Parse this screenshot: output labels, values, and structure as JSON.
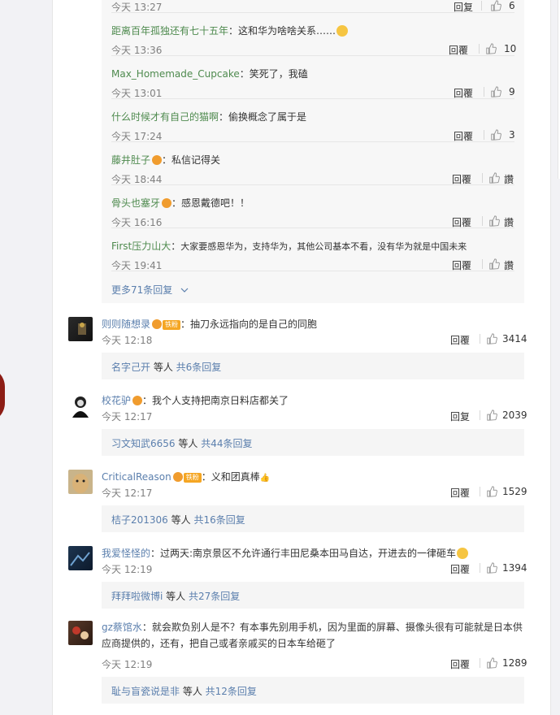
{
  "replies": [
    {
      "user": "",
      "text": "",
      "time": "今天 13:27",
      "reply": "回复",
      "likes": "6"
    },
    {
      "user": "距离百年孤独还有七十五年",
      "text": "这和华为啥啥关系……",
      "emoji": "true",
      "time": "今天 13:36",
      "reply": "回覆",
      "likes": "10"
    },
    {
      "user": "Max_Homemade_Cupcake",
      "text": "笑死了，我磕",
      "time": "今天 13:01",
      "reply": "回覆",
      "likes": "9"
    },
    {
      "user": "什么时候才有自己的猫啊",
      "text": "偷换概念了属于是",
      "time": "今天 17:24",
      "reply": "回覆",
      "likes": "3"
    },
    {
      "user": "藤井肚子",
      "text": "私信记得关",
      "time": "今天 18:44",
      "reply": "回覆",
      "likes": "讚"
    },
    {
      "user": "骨头也塞牙",
      "text": "感恩戴德吧！！",
      "time": "今天 16:16",
      "reply": "回覆",
      "likes": "讚"
    },
    {
      "user": "First压力山大",
      "text": "大家要感恩华为，支持华为，其他公司基本不看，没有华为就是中国未来",
      "time": "今天 19:41",
      "reply": "回覆",
      "likes": "讚"
    }
  ],
  "more_replies": "更多71条回复",
  "comments": [
    {
      "user": "则则随想录",
      "badge": "铁粉",
      "text": "：抽刀永远指向的是自己的同胞",
      "time": "今天 12:18",
      "reply": "回覆",
      "likes": "3414",
      "sub_user": "名字己开",
      "sub_rest": " 等人 ",
      "sub_count": "共6条回复"
    },
    {
      "user": "校花驴",
      "text": "：我个人支持把南京日料店都关了",
      "time": "今天 12:17",
      "reply": "回复",
      "likes": "2039",
      "sub_user": "习文知武6656",
      "sub_rest": " 等人 ",
      "sub_count": "共44条回复"
    },
    {
      "user": "CriticalReason",
      "badge": "铁粉",
      "text": "：义和团真棒",
      "time": "今天 12:17",
      "reply": "回覆",
      "likes": "1529",
      "sub_user": "桔子201306",
      "sub_rest": " 等人 ",
      "sub_count": "共16条回复"
    },
    {
      "user": "我爱怪怪的",
      "text": "：过两天:南京景区不允许通行丰田尼桑本田马自达，开进去的一律砸车",
      "time": "今天 12:19",
      "reply": "回覆",
      "likes": "1394",
      "sub_user": "拜拜啦微博i",
      "sub_rest": " 等人 ",
      "sub_count": "共27条回复"
    },
    {
      "user": "gz蔡馆水",
      "text": "：就会欺负别人是不？有本事先别用手机，因为里面的屏幕、摄像头很有可能就是日本供应商提供的，还有，把自己或者亲戚买的日本车给砸了",
      "time": "今天 12:19",
      "reply": "回覆",
      "likes": "1289",
      "sub_user": "耻与盲瓷说是非",
      "sub_rest": " 等人 ",
      "sub_count": "共12条回复"
    }
  ],
  "colors": {
    "username": "#5b7fad",
    "reply_username": "#4e8a4e",
    "meta": "#808080",
    "panel": "#f7f7f7"
  },
  "icons": [
    "thumbs-up-icon",
    "chevron-down-icon",
    "vip-icon",
    "emoji-icon"
  ]
}
